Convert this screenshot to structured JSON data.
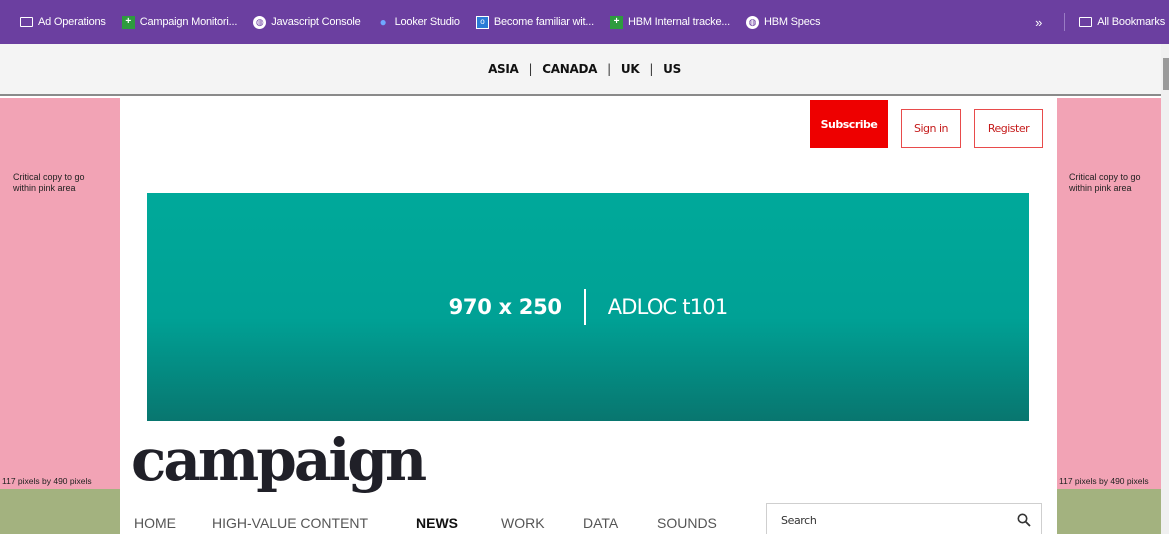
{
  "bookmarks": [
    {
      "icon": "folder-icon",
      "label": "Ad Operations"
    },
    {
      "icon": "plus-icon",
      "label": "Campaign Monitori..."
    },
    {
      "icon": "globe-icon",
      "label": "Javascript Console"
    },
    {
      "icon": "looker-icon",
      "label": "Looker Studio"
    },
    {
      "icon": "outlook-icon",
      "label": "Become familiar wit..."
    },
    {
      "icon": "plus-icon",
      "label": "HBM Internal tracke..."
    },
    {
      "icon": "globe-icon",
      "label": "HBM Specs"
    }
  ],
  "bookmarks_more": "»",
  "all_bookmarks": "All Bookmarks",
  "editions": [
    "ASIA",
    "CANADA",
    "UK",
    "US"
  ],
  "edition_separator": "|",
  "header": {
    "subscribe": "Subscribe",
    "signin": "Sign in",
    "register": "Register"
  },
  "skin": {
    "copy": "Critical copy to go within pink area",
    "dims": "117 pixels by 490 pixels",
    "pink_color": "#f2a3b5",
    "green_color": "#a3b27f"
  },
  "ad": {
    "size": "970 x 250",
    "adloc": "ADLOC t101",
    "color": "#00a99a"
  },
  "logo": "campaign",
  "nav": [
    "HOME",
    "HIGH-VALUE CONTENT",
    "NEWS",
    "WORK",
    "DATA",
    "SOUNDS"
  ],
  "nav_active": "NEWS",
  "search": {
    "placeholder": "Search"
  },
  "colors": {
    "bookmark_bar": "#6b3fa0",
    "subscribe": "#ee0000",
    "brand_red": "#c51a1a"
  }
}
